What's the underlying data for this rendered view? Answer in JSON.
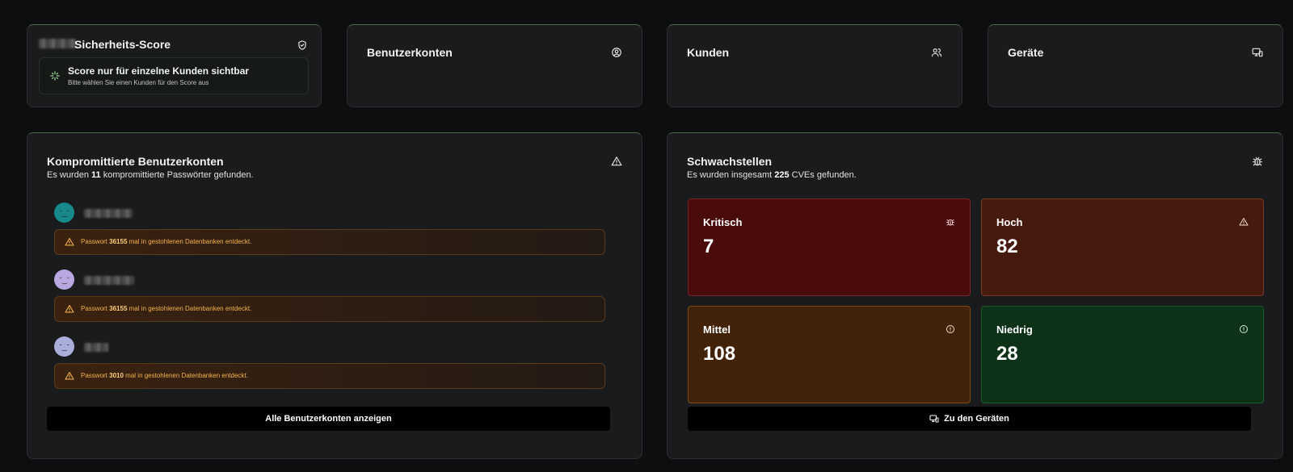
{
  "score": {
    "title": "Sicherheits-Score",
    "message_title": "Score nur für einzelne Kunden sichtbar",
    "message_sub": "Bitte wählen Sie einen Kunden für den Score aus"
  },
  "users_card": {
    "title": "Benutzerkonten"
  },
  "customers_card": {
    "title": "Kunden"
  },
  "devices_card": {
    "title": "Geräte"
  },
  "compromised": {
    "title": "Kompromittierte Benutzerkonten",
    "sub_prefix": "Es wurden",
    "count": "11",
    "sub_suffix": "kompromittierte Passwörter gefunden.",
    "accounts": [
      {
        "alert_prefix": "Passwort",
        "times": "36155",
        "alert_suffix": "mal in gestohlenen Datenbanken entdeckt.",
        "avatar_color": "#16898a"
      },
      {
        "alert_prefix": "Passwort",
        "times": "36155",
        "alert_suffix": "mal in gestohlenen Datenbanken entdeckt.",
        "avatar_color": "#b9a8df"
      },
      {
        "alert_prefix": "Passwort",
        "times": "3010",
        "alert_suffix": "mal in gestohlenen Datenbanken entdeckt.",
        "avatar_color": "#a9aedb"
      }
    ],
    "button": "Alle Benutzerkonten anzeigen"
  },
  "vulns": {
    "title": "Schwachstellen",
    "sub_prefix": "Es wurden insgesamt",
    "count": "225",
    "sub_suffix": "CVEs gefunden.",
    "critical": {
      "label": "Kritisch",
      "value": "7"
    },
    "high": {
      "label": "Hoch",
      "value": "82"
    },
    "medium": {
      "label": "Mittel",
      "value": "108"
    },
    "low": {
      "label": "Niedrig",
      "value": "28"
    },
    "button": "Zu den Geräten"
  }
}
